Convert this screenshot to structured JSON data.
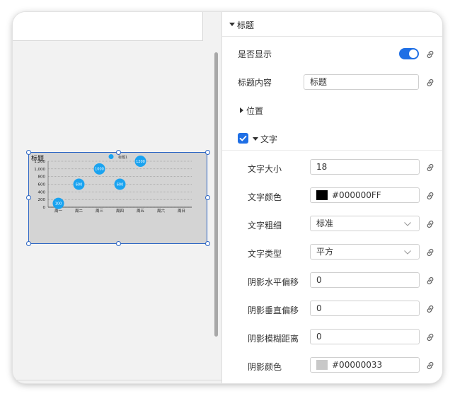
{
  "chart": {
    "title": "标题",
    "legend": "标题1",
    "y_ticks": [
      "1,200",
      "1,000",
      "800",
      "600",
      "400",
      "200",
      "0"
    ],
    "x_categories": [
      "周一",
      "周二",
      "周三",
      "周四",
      "周五",
      "周六",
      "周日"
    ],
    "bubbles": [
      {
        "category": "周一",
        "value": 100,
        "label": "100"
      },
      {
        "category": "周二",
        "value": 600,
        "label": "600"
      },
      {
        "category": "周三",
        "value": 1000,
        "label": "1000"
      },
      {
        "category": "周四",
        "value": 600,
        "label": "600"
      },
      {
        "category": "周五",
        "value": 1200,
        "label": "1200"
      }
    ]
  },
  "chart_data": {
    "type": "scatter",
    "title": "标题",
    "categories": [
      "周一",
      "周二",
      "周三",
      "周四",
      "周五",
      "周六",
      "周日"
    ],
    "series": [
      {
        "name": "标题1",
        "values": [
          100,
          600,
          1000,
          600,
          1200,
          null,
          null
        ]
      }
    ],
    "ylim": [
      0,
      1200
    ],
    "grid": true,
    "legend_position": "top"
  },
  "panel": {
    "section_title": "标题",
    "show_label": "是否显示",
    "show_value": true,
    "content_label": "标题内容",
    "content_value": "标题",
    "position_label": "位置",
    "text_label": "文字",
    "text_checked": true,
    "font_size_label": "文字大小",
    "font_size_value": "18",
    "text_color_label": "文字颜色",
    "text_color_value": "#000000FF",
    "text_color_swatch": "#000000",
    "font_weight_label": "文字粗细",
    "font_weight_value": "标准",
    "font_type_label": "文字类型",
    "font_type_value": "平方",
    "shadow_x_label": "阴影水平偏移",
    "shadow_x_value": "0",
    "shadow_y_label": "阴影垂直偏移",
    "shadow_y_value": "0",
    "shadow_blur_label": "阴影模糊距离",
    "shadow_blur_value": "0",
    "shadow_color_label": "阴影颜色",
    "shadow_color_value": "#00000033",
    "shadow_color_swatch": "#c8c8c8"
  },
  "colors": {
    "accent": "#1f6fe5",
    "bubble": "#1aa3f0",
    "selection": "#2a64c4"
  }
}
